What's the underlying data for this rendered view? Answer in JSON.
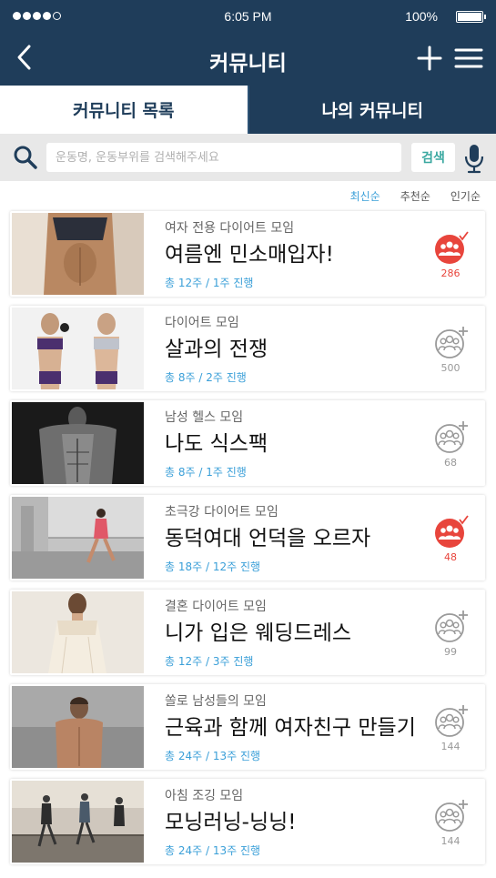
{
  "status_bar": {
    "time": "6:05 PM",
    "battery": "100%"
  },
  "nav": {
    "title": "커뮤니티",
    "back_icon": "chevron-left-icon",
    "add_icon": "plus-icon",
    "menu_icon": "hamburger-menu-icon"
  },
  "tabs": [
    {
      "label": "커뮤니티 목록",
      "active": true
    },
    {
      "label": "나의 커뮤니티",
      "active": false
    }
  ],
  "search": {
    "placeholder": "운동명, 운동부위를 검색해주세요",
    "value": "",
    "button_label": "검색"
  },
  "sort": [
    {
      "label": "최신순",
      "active": true
    },
    {
      "label": "추천순",
      "active": false
    },
    {
      "label": "인기순",
      "active": false
    }
  ],
  "colors": {
    "primary": "#1f3d5a",
    "accent_blue": "#3a9fd8",
    "accent_teal": "#3aa8a0",
    "joined_red": "#e8453c",
    "not_joined_gray": "#9a9a9a"
  },
  "communities": [
    {
      "category": "여자 전용 다이어트 모임",
      "title": "여름엔 민소매입자!",
      "meta": "총 12주 / 1주 진행",
      "members": "286",
      "joined": true
    },
    {
      "category": "다이어트 모임",
      "title": "살과의 전쟁",
      "meta": "총 8주 / 2주 진행",
      "members": "500",
      "joined": false
    },
    {
      "category": "남성 헬스 모임",
      "title": "나도 식스팩",
      "meta": "총 8주 / 1주 진행",
      "members": "68",
      "joined": false
    },
    {
      "category": "초극강 다이어트 모임",
      "title": "동덕여대 언덕을 오르자",
      "meta": "총 18주 / 12주 진행",
      "members": "48",
      "joined": true
    },
    {
      "category": "결혼 다이어트 모임",
      "title": "니가 입은 웨딩드레스",
      "meta": "총 12주 / 3주 진행",
      "members": "99",
      "joined": false
    },
    {
      "category": "쏠로 남성들의 모임",
      "title": "근육과 함께 여자친구 만들기",
      "meta": "총 24주 / 13주 진행",
      "members": "144",
      "joined": false
    },
    {
      "category": "아침 조깅 모임",
      "title": "모닝러닝-닝닝!",
      "meta": "총 24주 / 13주 진행",
      "members": "144",
      "joined": false
    }
  ]
}
